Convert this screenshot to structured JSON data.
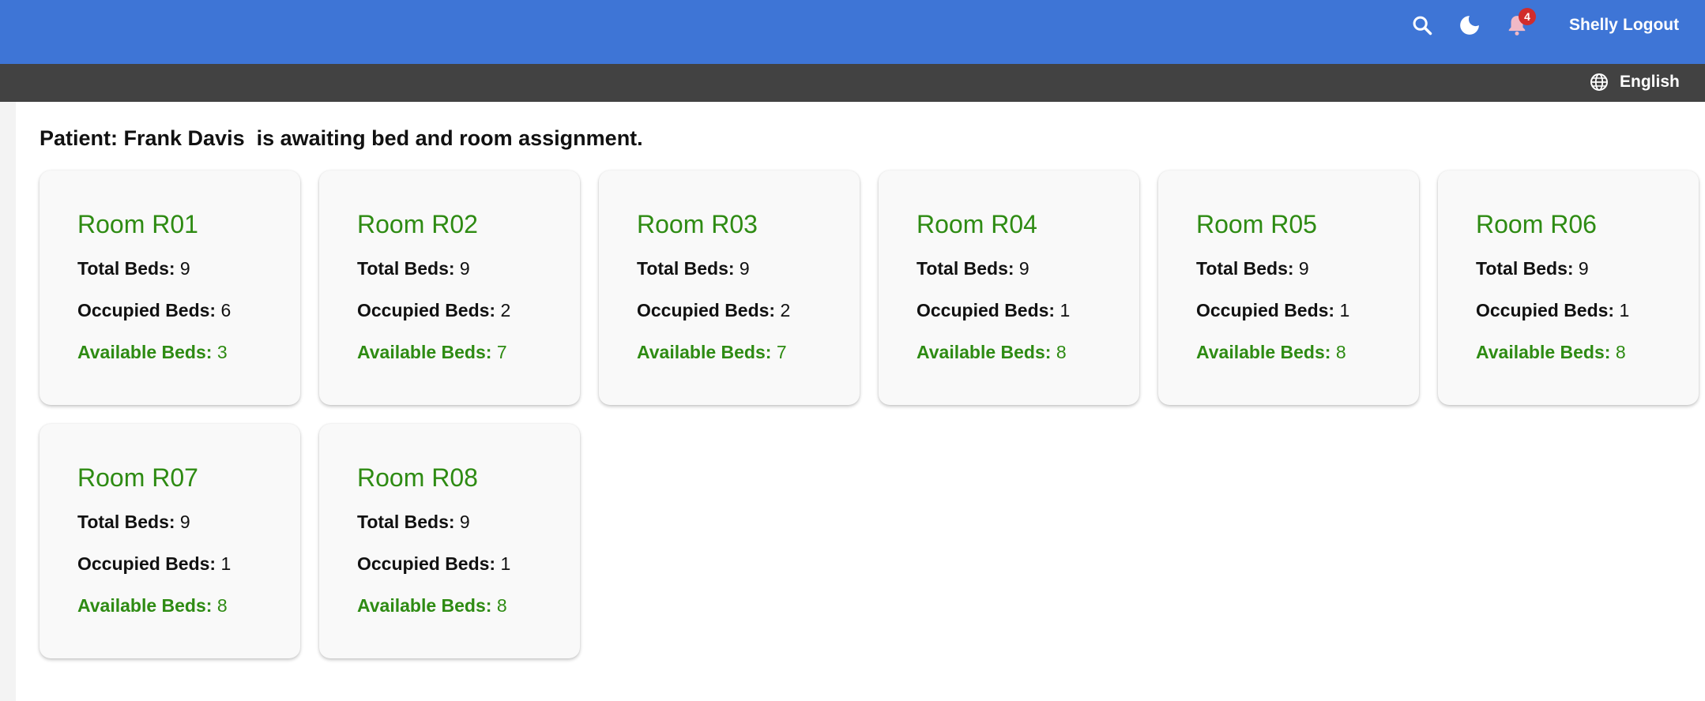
{
  "header": {
    "notification_count": "4",
    "user_name": "Shelly",
    "logout_label": "Logout",
    "colors": {
      "primary": "#3e75d6",
      "badge": "#d12c2c"
    },
    "icons": [
      "search-icon",
      "moon-icon",
      "bell-icon"
    ]
  },
  "subheader": {
    "language": "English",
    "icon": "globe-icon"
  },
  "main": {
    "patient_message": "Patient: Frank Davis  is awaiting bed and room assignment.",
    "labels": {
      "total": "Total Beds:",
      "occupied": "Occupied Beds:",
      "available": "Available Beds:"
    },
    "accent_color": "#2e8b13",
    "rooms": [
      {
        "name": "Room R01",
        "total": "9",
        "occupied": "6",
        "available": "3"
      },
      {
        "name": "Room R02",
        "total": "9",
        "occupied": "2",
        "available": "7"
      },
      {
        "name": "Room R03",
        "total": "9",
        "occupied": "2",
        "available": "7"
      },
      {
        "name": "Room R04",
        "total": "9",
        "occupied": "1",
        "available": "8"
      },
      {
        "name": "Room R05",
        "total": "9",
        "occupied": "1",
        "available": "8"
      },
      {
        "name": "Room R06",
        "total": "9",
        "occupied": "1",
        "available": "8"
      },
      {
        "name": "Room R07",
        "total": "9",
        "occupied": "1",
        "available": "8"
      },
      {
        "name": "Room R08",
        "total": "9",
        "occupied": "1",
        "available": "8"
      }
    ]
  }
}
